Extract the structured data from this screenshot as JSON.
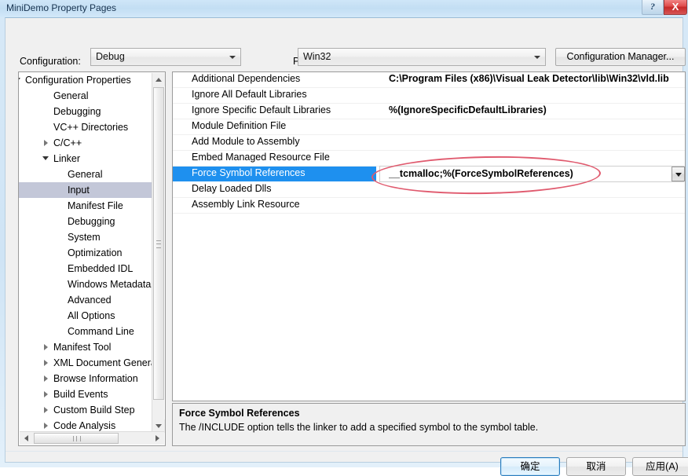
{
  "window": {
    "title": "MiniDemo Property Pages",
    "help_glyph": "?",
    "close_glyph": "X"
  },
  "toolbar": {
    "configuration_label": "Configuration:",
    "configuration_value": "Debug",
    "platform_label": "Platform:",
    "platform_value": "Win32",
    "config_manager_label": "Configuration Manager..."
  },
  "tree": [
    {
      "label": "Configuration Properties",
      "indent": 8,
      "expander": "open",
      "selected": false
    },
    {
      "label": "General",
      "indent": 44,
      "expander": "none",
      "selected": false
    },
    {
      "label": "Debugging",
      "indent": 44,
      "expander": "none",
      "selected": false
    },
    {
      "label": "VC++ Directories",
      "indent": 44,
      "expander": "none",
      "selected": false
    },
    {
      "label": "C/C++",
      "indent": 44,
      "expander": "closed",
      "selected": false
    },
    {
      "label": "Linker",
      "indent": 44,
      "expander": "open",
      "selected": false
    },
    {
      "label": "General",
      "indent": 62,
      "expander": "none",
      "selected": false
    },
    {
      "label": "Input",
      "indent": 62,
      "expander": "none",
      "selected": true
    },
    {
      "label": "Manifest File",
      "indent": 62,
      "expander": "none",
      "selected": false
    },
    {
      "label": "Debugging",
      "indent": 62,
      "expander": "none",
      "selected": false
    },
    {
      "label": "System",
      "indent": 62,
      "expander": "none",
      "selected": false
    },
    {
      "label": "Optimization",
      "indent": 62,
      "expander": "none",
      "selected": false
    },
    {
      "label": "Embedded IDL",
      "indent": 62,
      "expander": "none",
      "selected": false
    },
    {
      "label": "Windows Metadata",
      "indent": 62,
      "expander": "none",
      "selected": false
    },
    {
      "label": "Advanced",
      "indent": 62,
      "expander": "none",
      "selected": false
    },
    {
      "label": "All Options",
      "indent": 62,
      "expander": "none",
      "selected": false
    },
    {
      "label": "Command Line",
      "indent": 62,
      "expander": "none",
      "selected": false
    },
    {
      "label": "Manifest Tool",
      "indent": 44,
      "expander": "closed",
      "selected": false
    },
    {
      "label": "XML Document Generator",
      "indent": 44,
      "expander": "closed",
      "selected": false
    },
    {
      "label": "Browse Information",
      "indent": 44,
      "expander": "closed",
      "selected": false
    },
    {
      "label": "Build Events",
      "indent": 44,
      "expander": "closed",
      "selected": false
    },
    {
      "label": "Custom Build Step",
      "indent": 44,
      "expander": "closed",
      "selected": false
    },
    {
      "label": "Code Analysis",
      "indent": 44,
      "expander": "closed",
      "selected": false
    }
  ],
  "properties": [
    {
      "name": "Additional Dependencies",
      "value": "C:\\Program Files (x86)\\Visual Leak Detector\\lib\\Win32\\vld.lib",
      "selected": false
    },
    {
      "name": "Ignore All Default Libraries",
      "value": "",
      "selected": false
    },
    {
      "name": "Ignore Specific Default Libraries",
      "value": "%(IgnoreSpecificDefaultLibraries)",
      "selected": false
    },
    {
      "name": "Module Definition File",
      "value": "",
      "selected": false
    },
    {
      "name": "Add Module to Assembly",
      "value": "",
      "selected": false
    },
    {
      "name": "Embed Managed Resource File",
      "value": "",
      "selected": false
    },
    {
      "name": "Force Symbol References",
      "value": "__tcmalloc;%(ForceSymbolReferences)",
      "selected": true
    },
    {
      "name": "Delay Loaded Dlls",
      "value": "",
      "selected": false
    },
    {
      "name": "Assembly Link Resource",
      "value": "",
      "selected": false
    }
  ],
  "description": {
    "title": "Force Symbol References",
    "text": "The /INCLUDE option tells the linker to add a specified symbol to the symbol table."
  },
  "buttons": {
    "ok": "确定",
    "cancel": "取消",
    "apply": "应用(A)"
  },
  "colors": {
    "selection_blue": "#1e90ef",
    "tree_selection": "#c3c7d8",
    "annotation_red": "#e05a6e",
    "titlebar": "#cfe6f8"
  }
}
